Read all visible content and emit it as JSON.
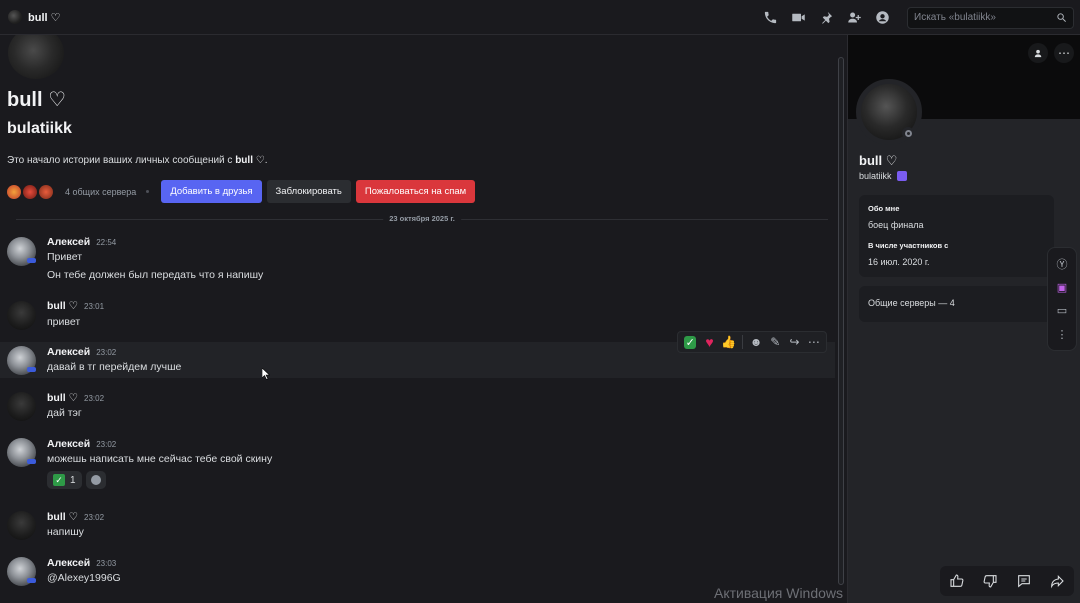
{
  "header": {
    "title": "bull ♡",
    "search_placeholder": "Искать «bulatiikk»"
  },
  "intro": {
    "display_name": "bull ♡",
    "username": "bulatiikk",
    "text_prefix": "Это начало истории ваших личных сообщений с ",
    "text_name": "bull ♡",
    "text_suffix": ".",
    "mutual_servers": "4 общих сервера",
    "add_friend": "Добавить в друзья",
    "block": "Заблокировать",
    "report_spam": "Пожаловаться на спам"
  },
  "date_divider": "23 октября 2025 г.",
  "messages": [
    {
      "author": "Алексей",
      "time": "22:54",
      "lines": [
        "Привет",
        "Он тебе должен был передать что я напишу"
      ]
    },
    {
      "author": "bull ♡",
      "time": "23:01",
      "lines": [
        "привет"
      ]
    },
    {
      "author": "Алексей",
      "time": "23:02",
      "lines": [
        "давай в тг перейдем лучше"
      ]
    },
    {
      "author": "bull ♡",
      "time": "23:02",
      "lines": [
        "дай тэг"
      ]
    },
    {
      "author": "Алексей",
      "time": "23:02",
      "lines": [
        "можешь написать мне сейчас тебе свой скину"
      ],
      "reaction_count": "1"
    },
    {
      "author": "bull ♡",
      "time": "23:02",
      "lines": [
        "напишу"
      ]
    },
    {
      "author": "Алексей",
      "time": "23:03",
      "lines": [
        "@Alexey1996G"
      ]
    }
  ],
  "profile": {
    "display_name": "bull ♡",
    "username": "bulatiikk",
    "about_label": "Обо мне",
    "about_value": "боец финала",
    "member_since_label": "В числе участников с",
    "member_since_value": "16 июл. 2020 г.",
    "mutual_servers": "Общие серверы — 4"
  },
  "watermark": "Активация Windows",
  "colors": {
    "accent": "#5865f2",
    "danger": "#da373c",
    "background": "#1a1a1e",
    "panel": "#232428"
  }
}
